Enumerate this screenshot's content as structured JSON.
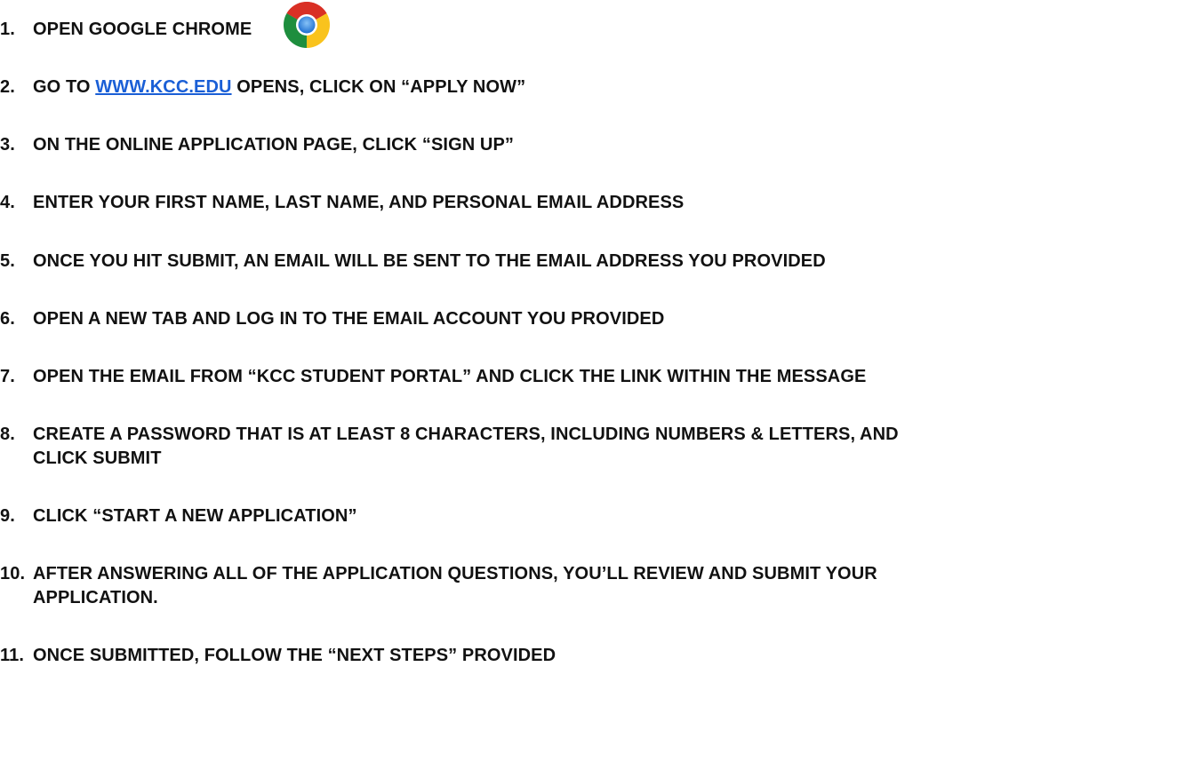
{
  "steps": [
    {
      "num": "1.",
      "text": "OPEN GOOGLE CHROME"
    },
    {
      "num": "2.",
      "pre": "GO TO ",
      "link": "WWW.KCC.EDU",
      "post": " OPENS, CLICK ON “APPLY NOW”"
    },
    {
      "num": "3.",
      "text": "ON THE ONLINE APPLICATION PAGE, CLICK “SIGN UP”"
    },
    {
      "num": "4.",
      "text": "ENTER YOUR FIRST NAME, LAST NAME, AND PERSONAL EMAIL ADDRESS"
    },
    {
      "num": "5.",
      "text": "ONCE YOU HIT SUBMIT, AN EMAIL WILL BE SENT TO THE EMAIL ADDRESS YOU PROVIDED"
    },
    {
      "num": "6.",
      "text": "OPEN A NEW TAB AND LOG IN TO THE EMAIL ACCOUNT YOU PROVIDED"
    },
    {
      "num": "7.",
      "text": "OPEN THE EMAIL FROM “KCC STUDENT PORTAL” AND CLICK THE LINK WITHIN THE MESSAGE"
    },
    {
      "num": "8.",
      "line1": "CREATE A PASSWORD THAT IS AT LEAST 8 CHARACTERS, INCLUDING NUMBERS & LETTERS, AND",
      "line2": "CLICK SUBMIT"
    },
    {
      "num": "9.",
      "text": "CLICK “START A NEW APPLICATION”"
    },
    {
      "num": "10.",
      "line1": "AFTER ANSWERING ALL OF THE APPLICATION QUESTIONS, YOU’LL REVIEW AND SUBMIT YOUR",
      "line2": "APPLICATION."
    },
    {
      "num": "11.",
      "text": "ONCE SUBMITTED, FOLLOW THE “NEXT STEPS” PROVIDED"
    }
  ],
  "icons": {
    "chrome": "google-chrome-logo"
  },
  "colors": {
    "text": "#111111",
    "link": "#1a5fd6"
  }
}
